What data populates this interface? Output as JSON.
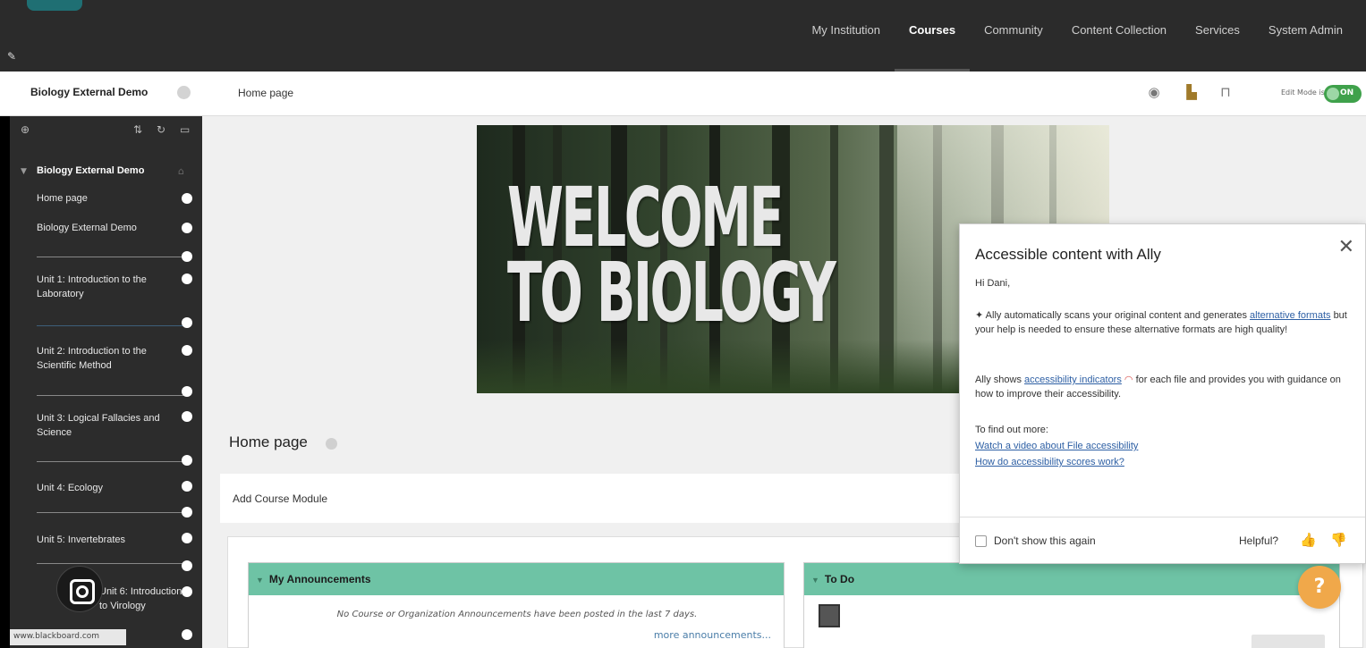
{
  "topnav": {
    "items": [
      "My Institution",
      "Courses",
      "Community",
      "Content Collection",
      "Services",
      "System Admin"
    ],
    "active": "Courses"
  },
  "breadcrumb": {
    "course_title": "Biology External Demo",
    "current_page": "Home page"
  },
  "toolbar": {
    "edit_mode_label": "Edit Mode is:",
    "edit_mode_value": "ON"
  },
  "sidebar": {
    "course_title": "Biology External Demo",
    "items": [
      "Home page",
      "Biology External Demo",
      "Unit 1: Introduction to the Laboratory",
      "Unit 2: Introduction to the Scientific Method",
      "Unit 3: Logical Fallacies and Science",
      "Unit 4: Ecology",
      "Unit 5: Invertebrates",
      "Unit 6: Introduction to Virology"
    ],
    "status_url": "www.blackboard.com"
  },
  "banner": {
    "line1": "WELCOME",
    "line2": "TO BIOLOGY"
  },
  "main": {
    "heading": "Home page",
    "add_module": "Add Course Module",
    "modules": {
      "announcements": {
        "title": "My Announcements",
        "empty_text": "No Course or Organization Announcements have been posted in the last 7 days.",
        "more_link": "more announcements..."
      },
      "todo": {
        "title": "To Do"
      }
    }
  },
  "ally": {
    "title": "Accessible content with Ally",
    "greeting": "Hi Dani,",
    "p1_start": "Ally automatically scans your original content and generates",
    "p1_link": "alternative formats",
    "p1_end": "but your help is needed to ensure these alternative formats are high quality!",
    "p2_start": "Ally shows",
    "p2_link": "accessibility indicators",
    "p2_end": "for each file and provides you with guidance on how to improve their accessibility.",
    "find_out": "To find out more:",
    "link1": "Watch a video about File accessibility",
    "link2": "How do accessibility scores work?",
    "dont_show": "Don't show this again",
    "helpful": "Helpful?"
  },
  "colors": {
    "topbar": "#2b2b2b",
    "module_header": "#6ec3a5",
    "link": "#2d5fa4",
    "toggle_on": "#3fa14b",
    "help_button": "#f0a84a"
  },
  "icons": {
    "help_button": "question-icon"
  }
}
